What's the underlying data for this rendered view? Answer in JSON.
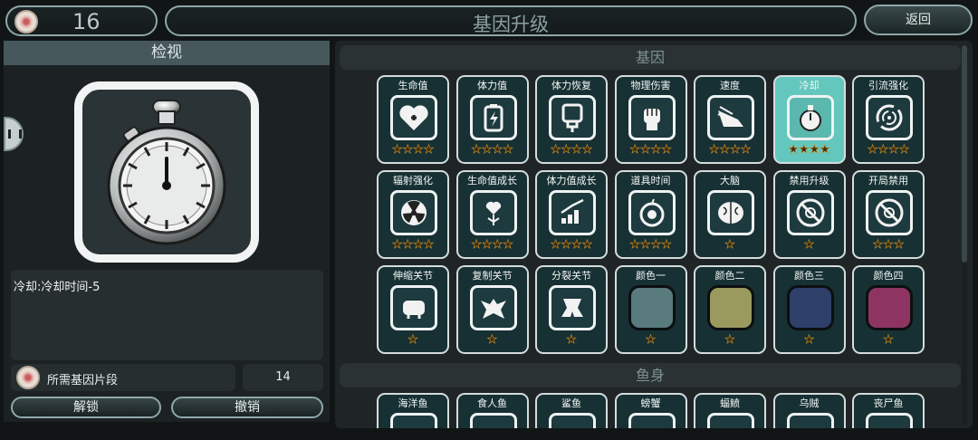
{
  "header": {
    "currency_value": "16",
    "title": "基因升级",
    "back_label": "返回"
  },
  "left_panel": {
    "title": "检视",
    "selected_icon": "stopwatch-icon",
    "description": "冷却:冷却时间-5",
    "required_label": "所需基因片段",
    "required_value": "14",
    "unlock_label": "解锁",
    "undo_label": "撤销"
  },
  "right_panel": {
    "gene_section_title": "基因",
    "fish_section_title": "鱼身",
    "genes": [
      {
        "name": "生命值",
        "icon": "heart-plus-icon",
        "stars": 4
      },
      {
        "name": "体力值",
        "icon": "battery-icon",
        "stars": 4
      },
      {
        "name": "体力恢复",
        "icon": "charger-icon",
        "stars": 4
      },
      {
        "name": "物理伤害",
        "icon": "fist-icon",
        "stars": 4
      },
      {
        "name": "速度",
        "icon": "winged-shoe-icon",
        "stars": 4
      },
      {
        "name": "冷却",
        "icon": "stopwatch-icon",
        "stars": 4,
        "selected": true
      },
      {
        "name": "引流强化",
        "icon": "vortex-icon",
        "stars": 4
      },
      {
        "name": "辐射强化",
        "icon": "radiation-icon",
        "stars": 4
      },
      {
        "name": "生命值成长",
        "icon": "growing-heart-icon",
        "stars": 4
      },
      {
        "name": "体力值成长",
        "icon": "growth-chart-icon",
        "stars": 4
      },
      {
        "name": "道具时间",
        "icon": "timer-apple-icon",
        "stars": 4
      },
      {
        "name": "大脑",
        "icon": "brain-icon",
        "stars": 1
      },
      {
        "name": "禁用升级",
        "icon": "banned-biohazard-icon",
        "stars": 1
      },
      {
        "name": "开局禁用",
        "icon": "banned-biohazard-icon",
        "stars": 3
      },
      {
        "name": "伸缩关节",
        "icon": "joint-bone-icon",
        "stars": 1
      },
      {
        "name": "复制关节",
        "icon": "vertebra-icon",
        "stars": 1
      },
      {
        "name": "分裂关节",
        "icon": "split-joint-icon",
        "stars": 1
      },
      {
        "name": "颜色一",
        "icon": "color-swatch",
        "color": "#597b7e",
        "stars": 1
      },
      {
        "name": "颜色二",
        "icon": "color-swatch",
        "color": "#9a9a5e",
        "stars": 1
      },
      {
        "name": "颜色三",
        "icon": "color-swatch",
        "color": "#2e3f6a",
        "stars": 1
      },
      {
        "name": "颜色四",
        "icon": "color-swatch",
        "color": "#8e3463",
        "stars": 1
      }
    ],
    "fish": [
      {
        "name": "海洋鱼"
      },
      {
        "name": "食人鱼"
      },
      {
        "name": "鲨鱼"
      },
      {
        "name": "螃蟹"
      },
      {
        "name": "蝠鲼"
      },
      {
        "name": "乌贼"
      },
      {
        "name": "丧尸鱼"
      }
    ]
  },
  "colors": {
    "selected_card": "#64c7bd",
    "card_bg": "#173033",
    "star_fill": "#3f2a0c",
    "star_outline": "#c6922c"
  }
}
